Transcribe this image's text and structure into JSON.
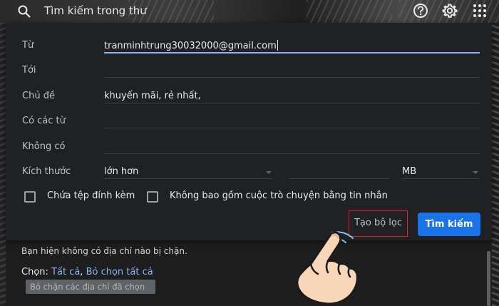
{
  "header": {
    "search_label": "Tìm kiếm trong thư"
  },
  "filter_dialog": {
    "from": {
      "label": "Từ",
      "value": "tranminhtrung30032000@gmail.com"
    },
    "to": {
      "label": "Tới",
      "value": ""
    },
    "subject": {
      "label": "Chủ đề",
      "value": "khuyến mãi, rẻ nhất,"
    },
    "has_words": {
      "label": "Có các từ",
      "value": ""
    },
    "doesnt_have": {
      "label": "Không có",
      "value": ""
    },
    "size": {
      "label": "Kích thước",
      "operator": "lớn hơn",
      "amount": "",
      "unit": "MB"
    },
    "has_attachment": {
      "label": "Chứa tệp đính kèm",
      "checked": false
    },
    "exclude_chats": {
      "label": "Không bao gồm cuộc trò chuyện bằng tin nhắn",
      "checked": false
    },
    "create_filter_label": "Tạo bộ lọc",
    "search_button_label": "Tìm kiếm"
  },
  "underlay": {
    "blocked_text": "Bạn hiện không có địa chỉ nào bị chặn.",
    "select_prefix": "Chọn:",
    "select_all": "Tất cả",
    "deselect_all": "Bỏ chọn tất cả",
    "unblock_selected": "Bỏ chặn các địa chỉ đã chọn"
  },
  "colors": {
    "dialog_bg": "#202124",
    "primary_button": "#1a73e8",
    "highlight_border": "#e0201b",
    "link": "#8ab4f8"
  }
}
